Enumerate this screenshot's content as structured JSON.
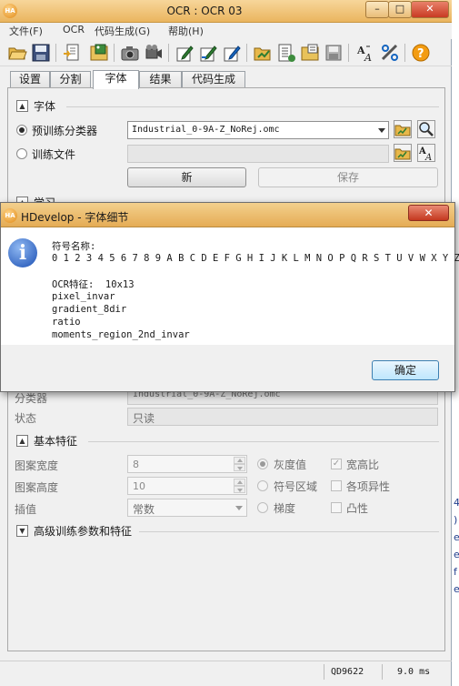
{
  "window": {
    "title": "OCR : OCR 03",
    "app_icon": "HA",
    "minimize": "–",
    "maximize": "□",
    "close": "✕"
  },
  "menu": [
    "文件(F)",
    "OCR",
    "代码生成(G)",
    "帮助(H)"
  ],
  "toolbar_icons": [
    "open-icon",
    "save-icon",
    "export-icon",
    "image-load-icon",
    "camera-icon",
    "grab-icon",
    "draw-icon",
    "draw-edit-icon",
    "train-icon",
    "read-icon",
    "batch-icon",
    "disk-icon",
    "font-icon",
    "settings-icon",
    "help-icon"
  ],
  "tabs": [
    "设置",
    "分割",
    "字体",
    "结果",
    "代码生成"
  ],
  "active_tab": "字体",
  "font_section": {
    "title": "字体",
    "pretrained_label": "预训练分类器",
    "pretrained_value": "Industrial_0-9A-Z_NoRej.omc",
    "train_file_label": "训练文件",
    "new_button": "新",
    "save_button": "保存"
  },
  "learn_section": {
    "title": "学习"
  },
  "classifier": {
    "label": "分类器",
    "value": "Industrial_0-9A-Z_NoRej.omc",
    "status_label": "状态",
    "status_value": "只读"
  },
  "basic_features": {
    "title": "基本特征",
    "width_label": "图案宽度",
    "width_value": "8",
    "height_label": "图案高度",
    "height_value": "10",
    "interp_label": "插值",
    "interp_value": "常数",
    "opt_gray": "灰度值",
    "opt_symbol_region": "符号区域",
    "opt_gradient": "梯度",
    "chk_aspect": "宽高比",
    "chk_anisotropy": "各项异性",
    "chk_convexity": "凸性",
    "checkmark": "✓"
  },
  "advanced_section": {
    "title": "高级训练参数和特征"
  },
  "status_bar": {
    "code": "QD9622",
    "time": "9.0 ms"
  },
  "background_fragments": [
    "4",
    ")",
    "e",
    "e",
    "f",
    "e"
  ],
  "dialog": {
    "title": "HDevelop - 字体细节",
    "info_glyph": "i",
    "symbols_label": "符号名称:",
    "symbols": "0 1 2 3 4 5 6 7 8 9 A B C D E F G H I J K L M N O P Q R S T U V W X Y Z",
    "ocr_features_line": "OCR特征:  10x13",
    "features": [
      "pixel_invar",
      "gradient_8dir",
      "ratio",
      "moments_region_2nd_invar"
    ],
    "ok_button": "确定"
  }
}
